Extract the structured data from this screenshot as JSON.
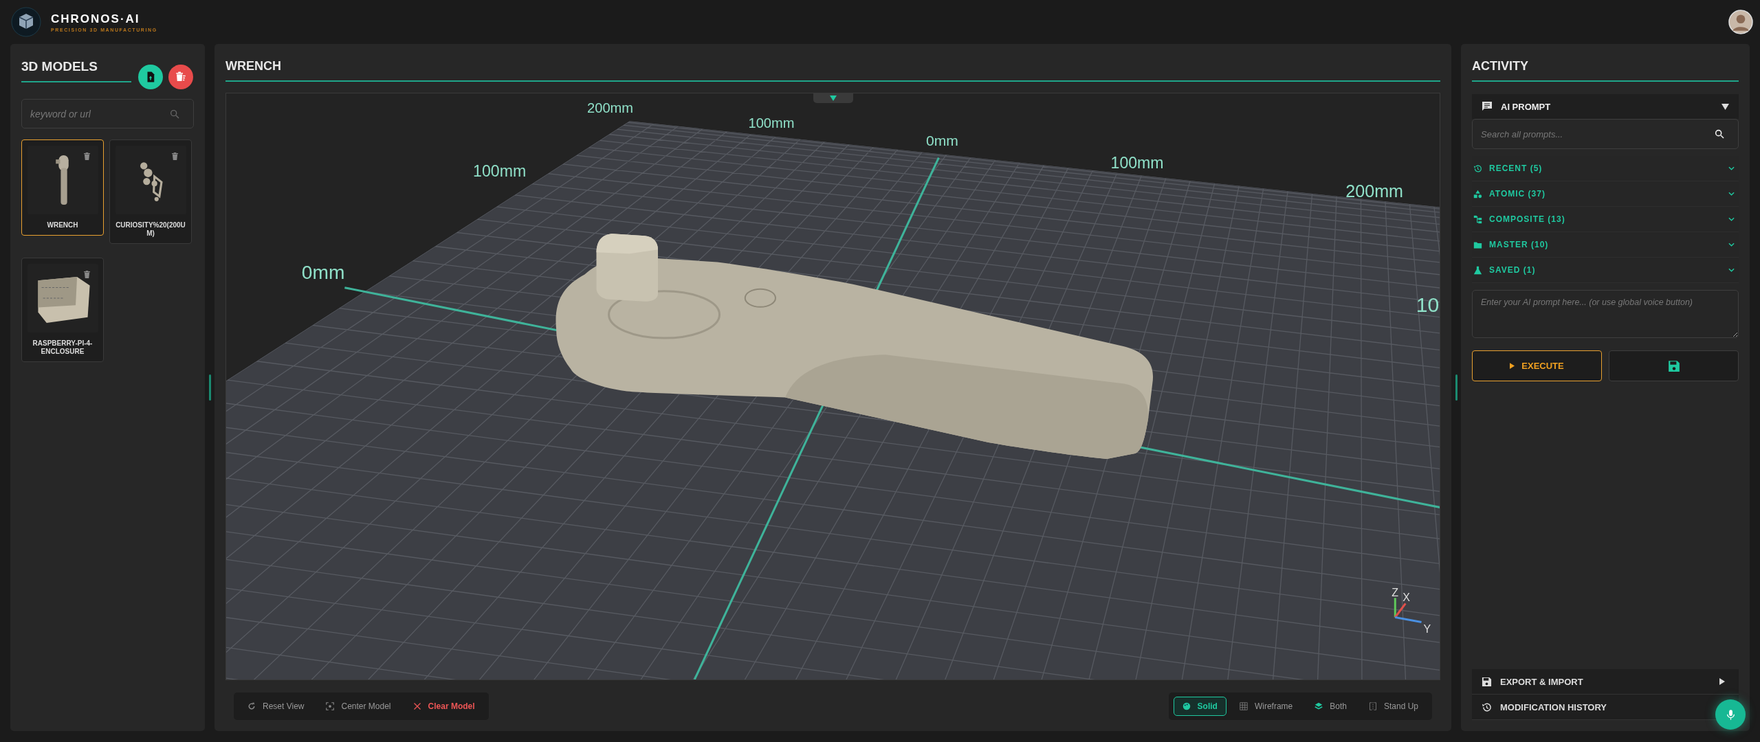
{
  "app": {
    "title": "CHRONOS·AI",
    "subtitle": "PRECISION 3D MANUFACTURING"
  },
  "models_panel": {
    "title": "3D MODELS",
    "search": {
      "placeholder": "keyword or url"
    },
    "models": [
      {
        "name": "WRENCH",
        "kind": "wrench",
        "selected": true
      },
      {
        "name": "CURIOSITY%20(200UM)",
        "kind": "rover",
        "selected": false
      },
      {
        "name": "RASPBERRY-PI-4-ENCLOSURE",
        "kind": "enclosure",
        "selected": false
      }
    ]
  },
  "viewer": {
    "title": "WRENCH",
    "scale_labels": [
      "200mm",
      "100mm",
      "0mm",
      "100mm",
      "200mm",
      "100mm",
      "0mm",
      "10"
    ],
    "gizmo_labels": [
      "Z",
      "X",
      "Y"
    ],
    "actions": [
      {
        "label": "Reset View",
        "kind": "reset"
      },
      {
        "label": "Center Model",
        "kind": "center"
      },
      {
        "label": "Clear Model",
        "kind": "clear"
      }
    ],
    "modes": [
      {
        "label": "Solid",
        "kind": "solid",
        "selected": true
      },
      {
        "label": "Wireframe",
        "kind": "wireframe",
        "selected": false
      },
      {
        "label": "Both",
        "kind": "both",
        "selected": false
      },
      {
        "label": "Stand Up",
        "kind": "standup",
        "selected": false
      }
    ]
  },
  "activity": {
    "title": "ACTIVITY",
    "prompt_section": {
      "title": "AI PROMPT",
      "expanded": true
    },
    "search": {
      "placeholder": "Search all prompts..."
    },
    "categories": [
      {
        "label": "RECENT (5)",
        "kind": "recent"
      },
      {
        "label": "ATOMIC (37)",
        "kind": "atomic"
      },
      {
        "label": "COMPOSITE (13)",
        "kind": "composite"
      },
      {
        "label": "MASTER (10)",
        "kind": "master"
      },
      {
        "label": "SAVED (1)",
        "kind": "saved"
      }
    ],
    "prompt_input": {
      "placeholder": "Enter your AI prompt here... (or use global voice button)"
    },
    "execute_label": "EXECUTE",
    "footer_sections": [
      {
        "label": "EXPORT & IMPORT",
        "kind": "export"
      },
      {
        "label": "MODIFICATION HISTORY",
        "kind": "history"
      }
    ]
  }
}
